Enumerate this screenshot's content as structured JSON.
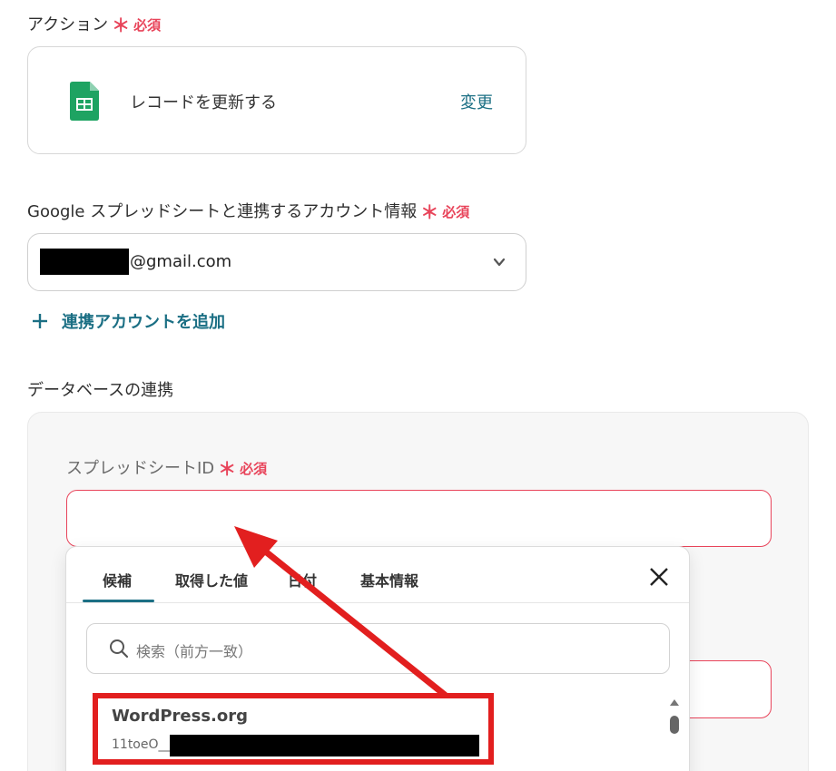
{
  "action": {
    "label": "アクション",
    "required_mark": "＊",
    "required_text": "必須",
    "action_name": "レコードを更新する",
    "change_label": "変更",
    "app_icon": "google-sheets-icon"
  },
  "account": {
    "label": "Google スプレッドシートと連携するアカウント情報",
    "required_mark": "＊",
    "required_text": "必須",
    "value_suffix": "@gmail.com",
    "add_label": "連携アカウントを追加"
  },
  "database": {
    "section_label": "データベースの連携",
    "spreadsheet_label": "スプレッドシートID",
    "required_mark": "＊",
    "required_text": "必須",
    "spreadsheet_value": ""
  },
  "picker": {
    "tabs": [
      {
        "label": "候補"
      },
      {
        "label": "取得した値"
      },
      {
        "label": "日付"
      },
      {
        "label": "基本情報"
      }
    ],
    "active_tab": "候補",
    "search_placeholder": "検索（前方一致）",
    "options": [
      {
        "title": "WordPress.org",
        "id_prefix": "11toeO__"
      }
    ]
  },
  "colors": {
    "accent": "#1b6f84",
    "required": "#e8445a",
    "annotation": "#e21f1f"
  }
}
